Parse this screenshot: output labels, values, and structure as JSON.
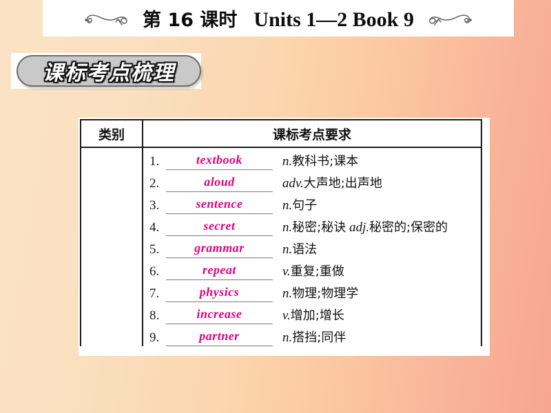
{
  "header": {
    "lesson_label": "第 16 课时",
    "units_label": "Units 1—2 Book 9",
    "left_ornament": "flourish-ornament-left",
    "right_ornament": "flourish-ornament-right"
  },
  "banner": {
    "title": "课标考点梳理",
    "pill_color": "#c9c9c9",
    "text_color": "#ffffff",
    "outline_color": "#111111"
  },
  "table": {
    "headers": {
      "category": "类别",
      "requirement": "课标考点要求"
    },
    "category_value": "",
    "accent_color": "#e3007f",
    "rows": [
      {
        "num": "1.",
        "word": "textbook",
        "pos": "n.",
        "cn": "教科书;课本"
      },
      {
        "num": "2.",
        "word": "aloud",
        "pos": "adv.",
        "cn": "大声地;出声地"
      },
      {
        "num": "3.",
        "word": "sentence",
        "pos": "n.",
        "cn": "句子"
      },
      {
        "num": "4.",
        "word": "secret",
        "pos": "n.",
        "cn": "秘密;秘诀",
        "pos2": "adj.",
        "cn2": "秘密的;保密的"
      },
      {
        "num": "5.",
        "word": "grammar",
        "pos": "n.",
        "cn": "语法"
      },
      {
        "num": "6.",
        "word": "repeat",
        "pos": "v.",
        "cn": "重复;重做"
      },
      {
        "num": "7.",
        "word": "physics",
        "pos": "n.",
        "cn": "物理;物理学"
      },
      {
        "num": "8.",
        "word": "increase",
        "pos": "v.",
        "cn": "增加;增长"
      },
      {
        "num": "9.",
        "word": "partner",
        "pos": "n.",
        "cn": "搭挡;同伴"
      }
    ]
  }
}
